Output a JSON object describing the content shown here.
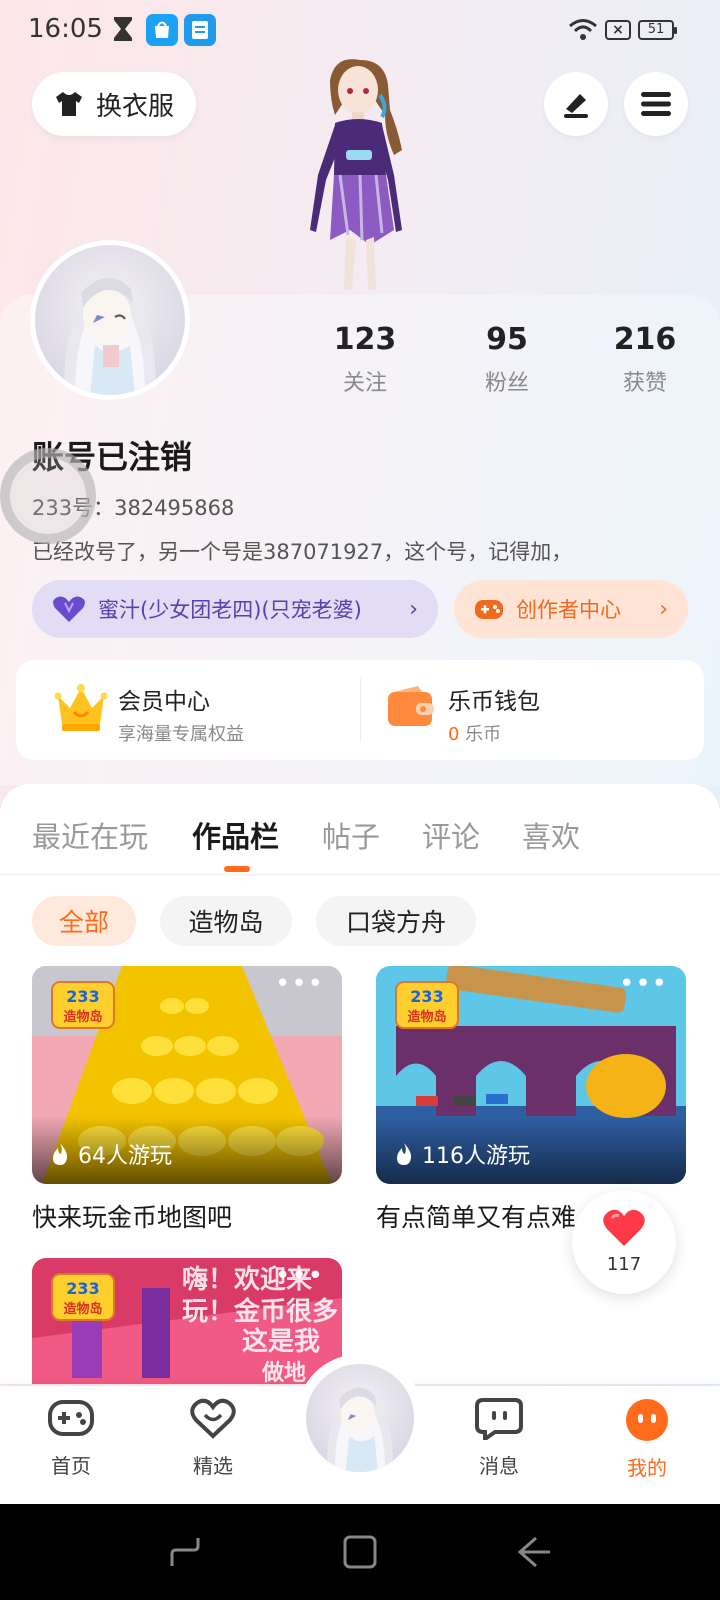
{
  "status_bar": {
    "time": "16:05",
    "battery": "51",
    "sim": "×"
  },
  "header": {
    "outfit_label": "换衣服"
  },
  "stats": [
    {
      "value": "123",
      "label": "关注"
    },
    {
      "value": "95",
      "label": "粉丝"
    },
    {
      "value": "216",
      "label": "获赞"
    }
  ],
  "profile": {
    "username": "账号已注销",
    "id_prefix": "233号：",
    "id_value": "382495868",
    "bio": "已经改号了，另一个号是387071927，这个号，记得加，"
  },
  "pills": {
    "group_label": "蜜汁(少女团老四)(只宠老婆)",
    "creator_label": "创作者中心"
  },
  "vip": {
    "member_title": "会员中心",
    "member_sub": "享海量专属权益",
    "wallet_title": "乐币钱包",
    "wallet_amount": "0",
    "wallet_unit": " 乐币"
  },
  "tabs": [
    "最近在玩",
    "作品栏",
    "帖子",
    "评论",
    "喜欢"
  ],
  "active_tab": "作品栏",
  "chips": [
    "全部",
    "造物岛",
    "口袋方舟"
  ],
  "works": [
    {
      "title": "快来玩金币地图吧",
      "plays": "64人游玩"
    },
    {
      "title": "有点简单又有点难",
      "plays": "116人游玩"
    },
    {
      "title": "",
      "plays": ""
    }
  ],
  "thumb_badge": {
    "line1": "233",
    "line2": "造物岛"
  },
  "third_thumb_text": [
    "嗨！欢迎来",
    "玩！金币很多",
    "这是我",
    "做地"
  ],
  "like": {
    "count": "117"
  },
  "bottom_nav": [
    {
      "label": "首页"
    },
    {
      "label": "精选"
    },
    {
      "label": "消息"
    },
    {
      "label": "我的"
    }
  ],
  "colors": {
    "accent": "#ff6b1a",
    "purple": "#5b3fb0"
  }
}
